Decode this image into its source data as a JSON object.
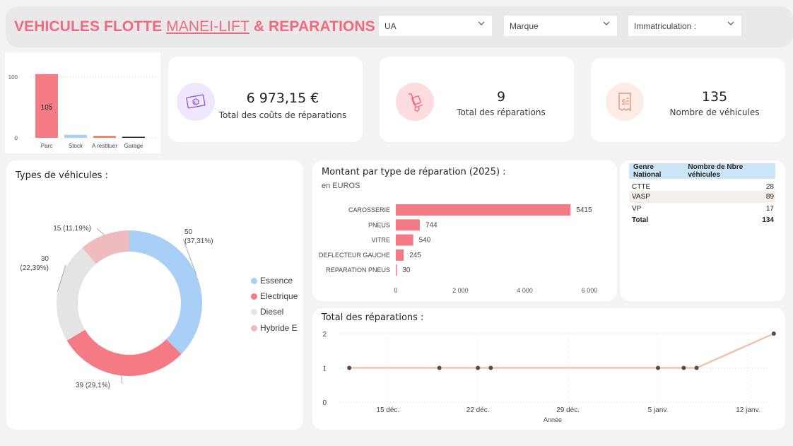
{
  "header": {
    "title_a": "VEHICULES FLOTTE ",
    "title_b": "MANEI-LIFT",
    "title_c": " & REPARATIONS :",
    "filters": [
      {
        "label": "UA"
      },
      {
        "label": "Marque"
      },
      {
        "label": "Immatriculation :"
      }
    ]
  },
  "kpis": [
    {
      "value": "6 973,15 €",
      "label": "Total des coûts de réparations",
      "icon": "money-icon",
      "color": "#8f5fd6"
    },
    {
      "value": "9",
      "label": "Total des réparations",
      "icon": "hand-truck-icon",
      "color": "#f06a7c"
    },
    {
      "value": "135",
      "label": "Nombre de véhicules",
      "icon": "receipt-icon",
      "color": "#e8937b"
    }
  ],
  "colors": {
    "accent": "#f06a7c",
    "bar": "#f47a86",
    "essence": "#a8d0f6",
    "electrique": "#f47a86",
    "diesel": "#e4e4e4",
    "hybride": "#eebcbf",
    "line": "#f2c3a8"
  },
  "chart_data": [
    {
      "type": "bar",
      "title": "",
      "categories": [
        "Parc",
        "Stock",
        "A restituer",
        "Garage"
      ],
      "values": [
        105,
        5,
        3,
        1
      ],
      "colors": [
        "#f47a86",
        "#a8d0f6",
        "#e57b57",
        "#252423"
      ],
      "data_labels": [
        "105"
      ],
      "yticks": [
        "0",
        "100"
      ],
      "ylim": [
        0,
        120
      ]
    },
    {
      "type": "pie",
      "title": "Types de véhicules :",
      "labels": [
        "Essence",
        "Electrique",
        "Diesel",
        "Hybride E"
      ],
      "values": [
        50,
        39,
        30,
        15
      ],
      "data_labels": [
        [
          "50",
          "(37,31%)"
        ],
        [
          "39 (29,1%)"
        ],
        [
          "30",
          "(22,39%)"
        ],
        [
          "15 (11,19%)"
        ]
      ],
      "colors": [
        "#a8d0f6",
        "#f47a86",
        "#e4e4e4",
        "#eebcbf"
      ],
      "legend": "right"
    },
    {
      "type": "bar",
      "title": "Montant par type de réparation (2025) :",
      "subtitle": "en EUROS",
      "categories": [
        "CAROSSERIE",
        "PNEUS",
        "VITRE",
        "DEFLECTEUR GAUCHE",
        "REPARATION PNEUS"
      ],
      "values": [
        5415,
        744,
        540,
        245,
        30
      ],
      "xticks": [
        "0",
        "2 000",
        "4 000",
        "6 000"
      ],
      "xlim": [
        0,
        6000
      ]
    },
    {
      "type": "table",
      "headers": [
        "Genre National",
        "Nombre de Nbre véhicules"
      ],
      "rows": [
        [
          "CTTE",
          "28"
        ],
        [
          "VASP",
          "89"
        ],
        [
          "VP",
          "17"
        ]
      ],
      "total": [
        "Total",
        "134"
      ]
    },
    {
      "type": "line",
      "title": "Total des réparations :",
      "xlabel": "Année",
      "x": [
        "2024-12-12",
        "2024-12-19",
        "2024-12-22",
        "2024-12-23",
        "2025-01-05",
        "2025-01-07",
        "2025-01-08",
        "2025-01-14"
      ],
      "y": [
        1,
        1,
        1,
        1,
        1,
        1,
        1,
        2
      ],
      "xticks": [
        "15 déc.",
        "22 déc.",
        "29 déc.",
        "5 janv.",
        "12 janv."
      ],
      "yticks": [
        "0",
        "1",
        "2"
      ],
      "ylim": [
        0,
        2
      ]
    }
  ]
}
